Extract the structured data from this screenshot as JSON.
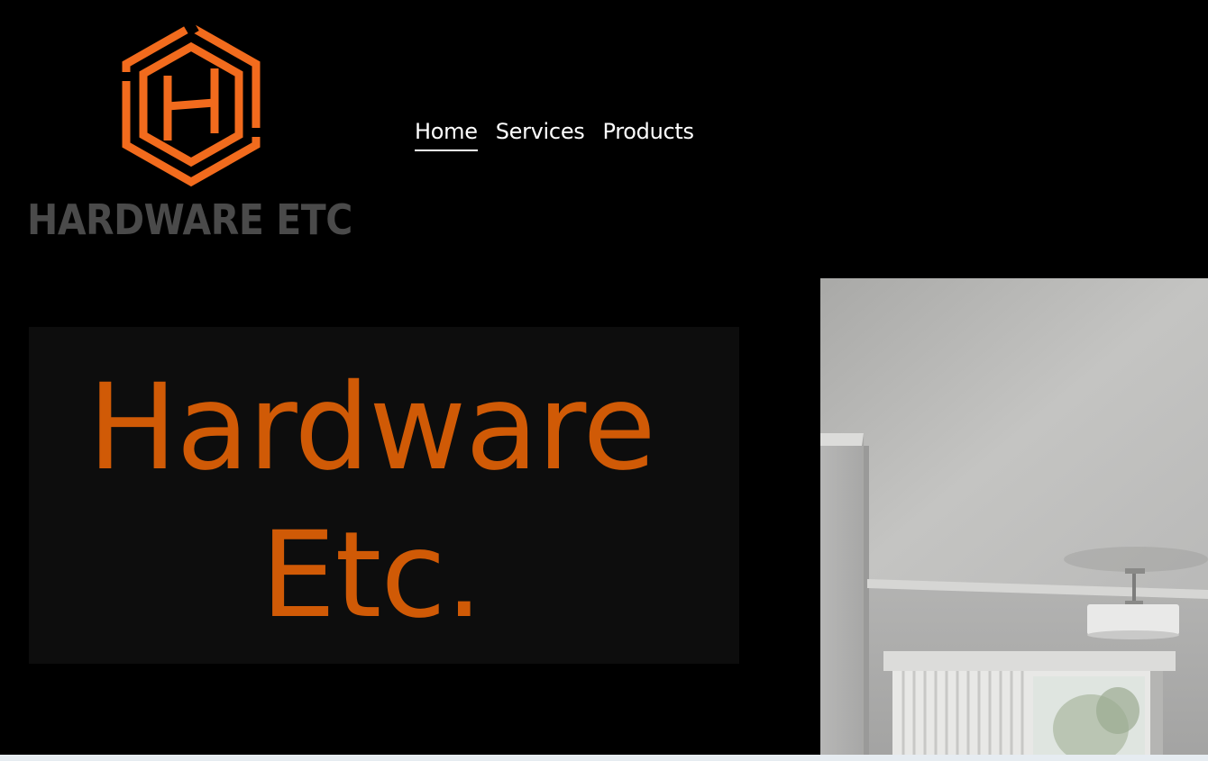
{
  "brand": {
    "logo_text": "HARDWARE ETC",
    "logo_icon": "hexagon-h-icon",
    "accent_color": "#f26b1d",
    "wordmark_color": "#4a4a4a"
  },
  "nav": {
    "items": [
      {
        "label": "Home",
        "active": true
      },
      {
        "label": "Services",
        "active": false
      },
      {
        "label": "Products",
        "active": false
      }
    ]
  },
  "hero": {
    "title": "Hardware Etc.",
    "title_color": "#d05a06",
    "background_color": "#0d0d0d"
  },
  "room_image": {
    "icon": "room-photo-image"
  }
}
